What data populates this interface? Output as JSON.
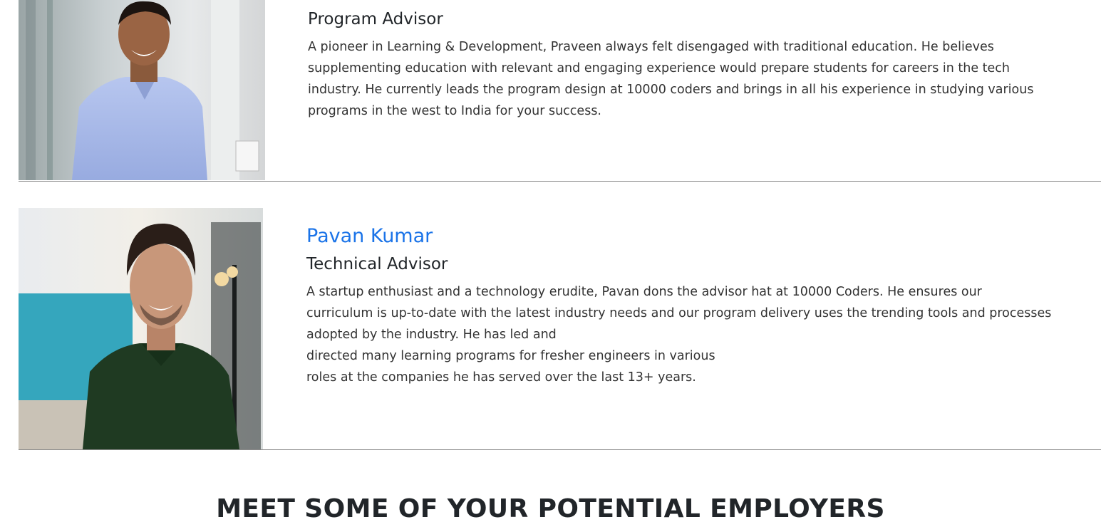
{
  "advisors": [
    {
      "name": "",
      "role": "Program Advisor",
      "bio_lines": [
        "A pioneer in Learning & Development, Praveen always felt disengaged with traditional education. He believes",
        "supplementing education with relevant and engaging experience would prepare students for careers in the tech",
        "industry. He currently leads the program design at 10000 coders and brings in all his experience in studying various",
        "programs in the west to India for your success."
      ],
      "photo_alt": "Praveen portrait"
    },
    {
      "name": "Pavan Kumar",
      "role": "Technical Advisor",
      "bio_lines": [
        "A startup enthusiast and a technology erudite, Pavan dons the advisor hat at 10000 Coders. He ensures our",
        "curriculum is up-to-date with the latest industry needs and our program delivery uses the trending tools and processes",
        "adopted by the industry. He has led and",
        "directed many learning programs for fresher engineers in various",
        "roles at the companies he has served over the last 13+ years."
      ],
      "photo_alt": "Pavan Kumar portrait"
    }
  ],
  "employers_section": {
    "title": "MEET SOME OF YOUR POTENTIAL EMPLOYERS"
  },
  "colors": {
    "name_link": "#1a73e8",
    "divider": "#8a8a8a",
    "text": "#212529"
  }
}
